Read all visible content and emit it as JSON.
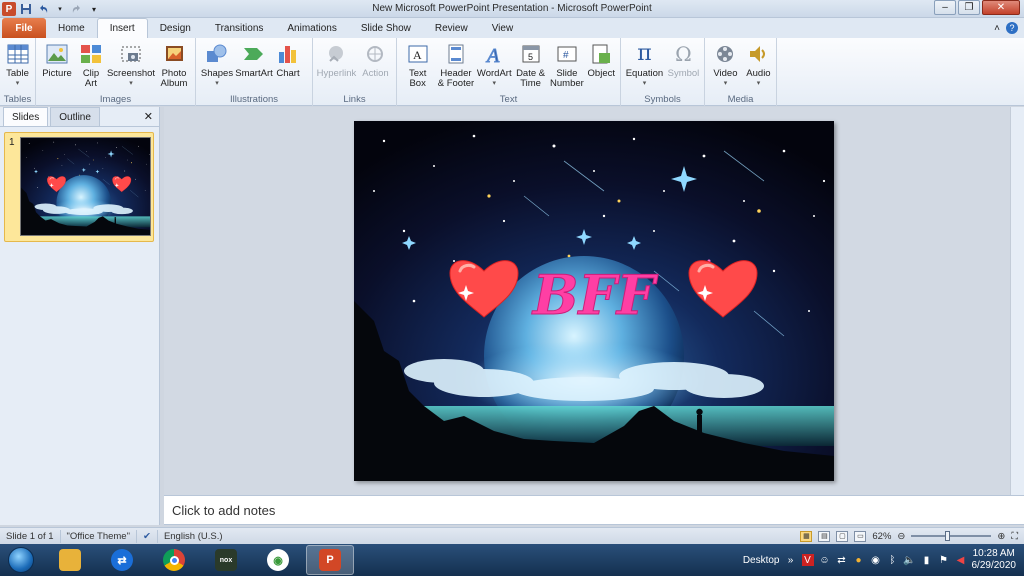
{
  "window": {
    "title": "New Microsoft PowerPoint Presentation  -  Microsoft PowerPoint"
  },
  "qat": {
    "logo": "P",
    "save": "save-icon",
    "undo": "undo-icon",
    "redo": "redo-icon"
  },
  "tabs": [
    {
      "label": "File"
    },
    {
      "label": "Home"
    },
    {
      "label": "Insert"
    },
    {
      "label": "Design"
    },
    {
      "label": "Transitions"
    },
    {
      "label": "Animations"
    },
    {
      "label": "Slide Show"
    },
    {
      "label": "Review"
    },
    {
      "label": "View"
    }
  ],
  "ribbon": {
    "groups": [
      {
        "label": "Tables",
        "buttons": [
          {
            "label": "Table"
          }
        ]
      },
      {
        "label": "Images",
        "buttons": [
          {
            "label": "Picture"
          },
          {
            "label": "Clip Art"
          },
          {
            "label": "Screenshot"
          },
          {
            "label": "Photo Album"
          }
        ]
      },
      {
        "label": "Illustrations",
        "buttons": [
          {
            "label": "Shapes"
          },
          {
            "label": "SmartArt"
          },
          {
            "label": "Chart"
          }
        ]
      },
      {
        "label": "Links",
        "buttons": [
          {
            "label": "Hyperlink"
          },
          {
            "label": "Action"
          }
        ]
      },
      {
        "label": "Text",
        "buttons": [
          {
            "label": "Text Box"
          },
          {
            "label": "Header & Footer"
          },
          {
            "label": "WordArt"
          },
          {
            "label": "Date & Time"
          },
          {
            "label": "Slide Number"
          },
          {
            "label": "Object"
          }
        ]
      },
      {
        "label": "Symbols",
        "buttons": [
          {
            "label": "Equation"
          },
          {
            "label": "Symbol"
          }
        ]
      },
      {
        "label": "Media",
        "buttons": [
          {
            "label": "Video"
          },
          {
            "label": "Audio"
          }
        ]
      }
    ]
  },
  "panel": {
    "tab_slides": "Slides",
    "tab_outline": "Outline",
    "slide_number": "1"
  },
  "slide": {
    "title": "BFF"
  },
  "notes": {
    "placeholder": "Click to add notes"
  },
  "status": {
    "slide_info": "Slide 1 of 1",
    "theme": "\"Office Theme\"",
    "language": "English (U.S.)",
    "zoom": "62%"
  },
  "taskbar": {
    "desktop_label": "Desktop",
    "time": "10:28 AM",
    "date": "6/29/2020"
  },
  "colors": {
    "ribbon_bg": "#fbfcfe",
    "file_tab": "#c8501f",
    "slide_text": "#ff3fa4",
    "heart": "#ff4a4a"
  }
}
